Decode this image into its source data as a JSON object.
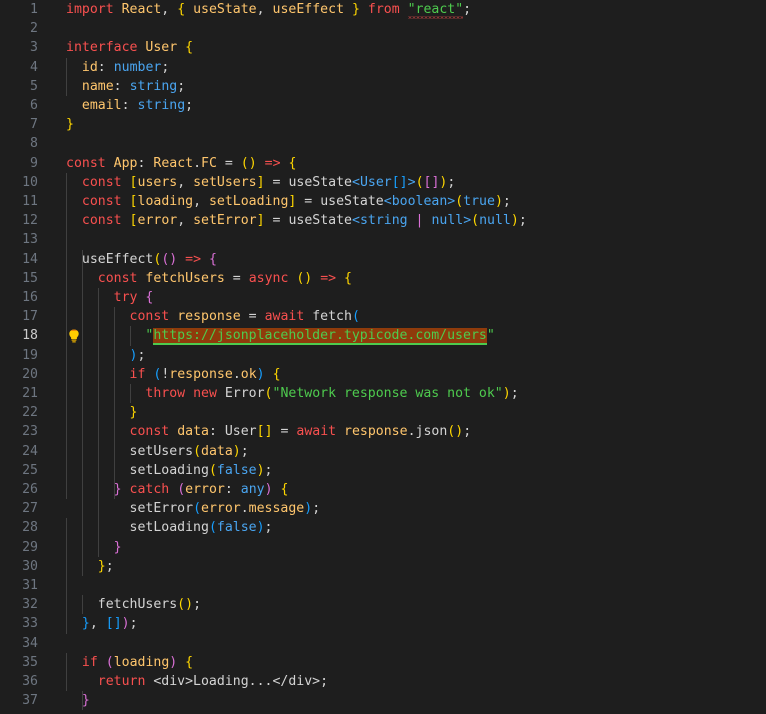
{
  "editor": {
    "title": "code-editor",
    "language": "TypeScript React",
    "theme": "dark",
    "background_color": "#1e1e1e",
    "first_visible_line": 1,
    "last_visible_line": 37,
    "active_line": 18,
    "tab_size": 2,
    "colors": {
      "keyword": "#f8504f",
      "identifier": "#ffc66d",
      "type": "#4aa5f0",
      "string": "#4ecb4e",
      "text": "#d4d4d4",
      "line_number": "#6e7681",
      "line_number_active": "#cccccc",
      "indent_guide": "#404040",
      "bracket_level_1": "#ffd700",
      "bracket_level_2": "#da70d6",
      "bracket_level_3": "#179fff",
      "link_highlight_bg": "#8f3b0b",
      "link_highlight_fg": "#4ecb4e",
      "error_squiggle": "#f14c4c"
    },
    "gutter": {
      "code_action_icon": "lightbulb-icon",
      "code_action_line": 18
    },
    "diagnostics": [
      {
        "line": 1,
        "text": "\"react\"",
        "kind": "error-squiggle"
      }
    ],
    "link_hover": {
      "line": 18,
      "text": "https://jsonplaceholder.typicode.com/users"
    },
    "lines": [
      {
        "n": 1,
        "text": "import React, { useState, useEffect } from \"react\";"
      },
      {
        "n": 2,
        "text": ""
      },
      {
        "n": 3,
        "text": "interface User {"
      },
      {
        "n": 4,
        "text": "  id: number;"
      },
      {
        "n": 5,
        "text": "  name: string;"
      },
      {
        "n": 6,
        "text": "  email: string;"
      },
      {
        "n": 7,
        "text": "}"
      },
      {
        "n": 8,
        "text": ""
      },
      {
        "n": 9,
        "text": "const App: React.FC = () => {"
      },
      {
        "n": 10,
        "text": "  const [users, setUsers] = useState<User[]>([]);"
      },
      {
        "n": 11,
        "text": "  const [loading, setLoading] = useState<boolean>(true);"
      },
      {
        "n": 12,
        "text": "  const [error, setError] = useState<string | null>(null);"
      },
      {
        "n": 13,
        "text": ""
      },
      {
        "n": 14,
        "text": "  useEffect(() => {"
      },
      {
        "n": 15,
        "text": "    const fetchUsers = async () => {"
      },
      {
        "n": 16,
        "text": "      try {"
      },
      {
        "n": 17,
        "text": "        const response = await fetch("
      },
      {
        "n": 18,
        "text": "          \"https://jsonplaceholder.typicode.com/users\""
      },
      {
        "n": 19,
        "text": "        );"
      },
      {
        "n": 20,
        "text": "        if (!response.ok) {"
      },
      {
        "n": 21,
        "text": "          throw new Error(\"Network response was not ok\");"
      },
      {
        "n": 22,
        "text": "        }"
      },
      {
        "n": 23,
        "text": "        const data: User[] = await response.json();"
      },
      {
        "n": 24,
        "text": "        setUsers(data);"
      },
      {
        "n": 25,
        "text": "        setLoading(false);"
      },
      {
        "n": 26,
        "text": "      } catch (error: any) {"
      },
      {
        "n": 27,
        "text": "        setError(error.message);"
      },
      {
        "n": 28,
        "text": "        setLoading(false);"
      },
      {
        "n": 29,
        "text": "      }"
      },
      {
        "n": 30,
        "text": "    };"
      },
      {
        "n": 31,
        "text": ""
      },
      {
        "n": 32,
        "text": "    fetchUsers();"
      },
      {
        "n": 33,
        "text": "  }, []);"
      },
      {
        "n": 34,
        "text": ""
      },
      {
        "n": 35,
        "text": "  if (loading) {"
      },
      {
        "n": 36,
        "text": "    return <div>Loading...</div>;"
      },
      {
        "n": 37,
        "text": "  }"
      }
    ]
  }
}
